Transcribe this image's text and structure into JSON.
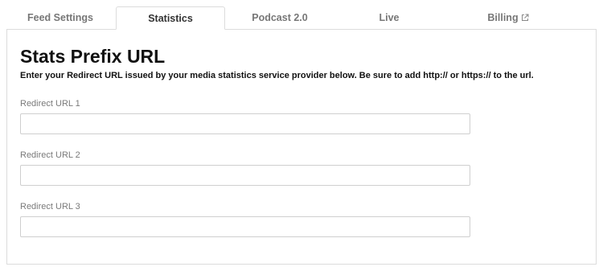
{
  "tabs": [
    {
      "label": "Feed Settings",
      "active": false
    },
    {
      "label": "Statistics",
      "active": true
    },
    {
      "label": "Podcast 2.0",
      "active": false
    },
    {
      "label": "Live",
      "active": false
    },
    {
      "label": "Billing",
      "active": false,
      "icon": "external-link-icon"
    }
  ],
  "section": {
    "title": "Stats Prefix URL",
    "description": "Enter your Redirect URL issued by your media statistics service provider below. Be sure to add http:// or https:// to the url."
  },
  "fields": [
    {
      "label": "Redirect URL 1",
      "value": ""
    },
    {
      "label": "Redirect URL 2",
      "value": ""
    },
    {
      "label": "Redirect URL 3",
      "value": ""
    }
  ],
  "colors": {
    "border": "#dcdcdc",
    "tab_inactive_text": "#777777",
    "tab_active_text": "#333333",
    "label_text": "#7a7a7a"
  }
}
